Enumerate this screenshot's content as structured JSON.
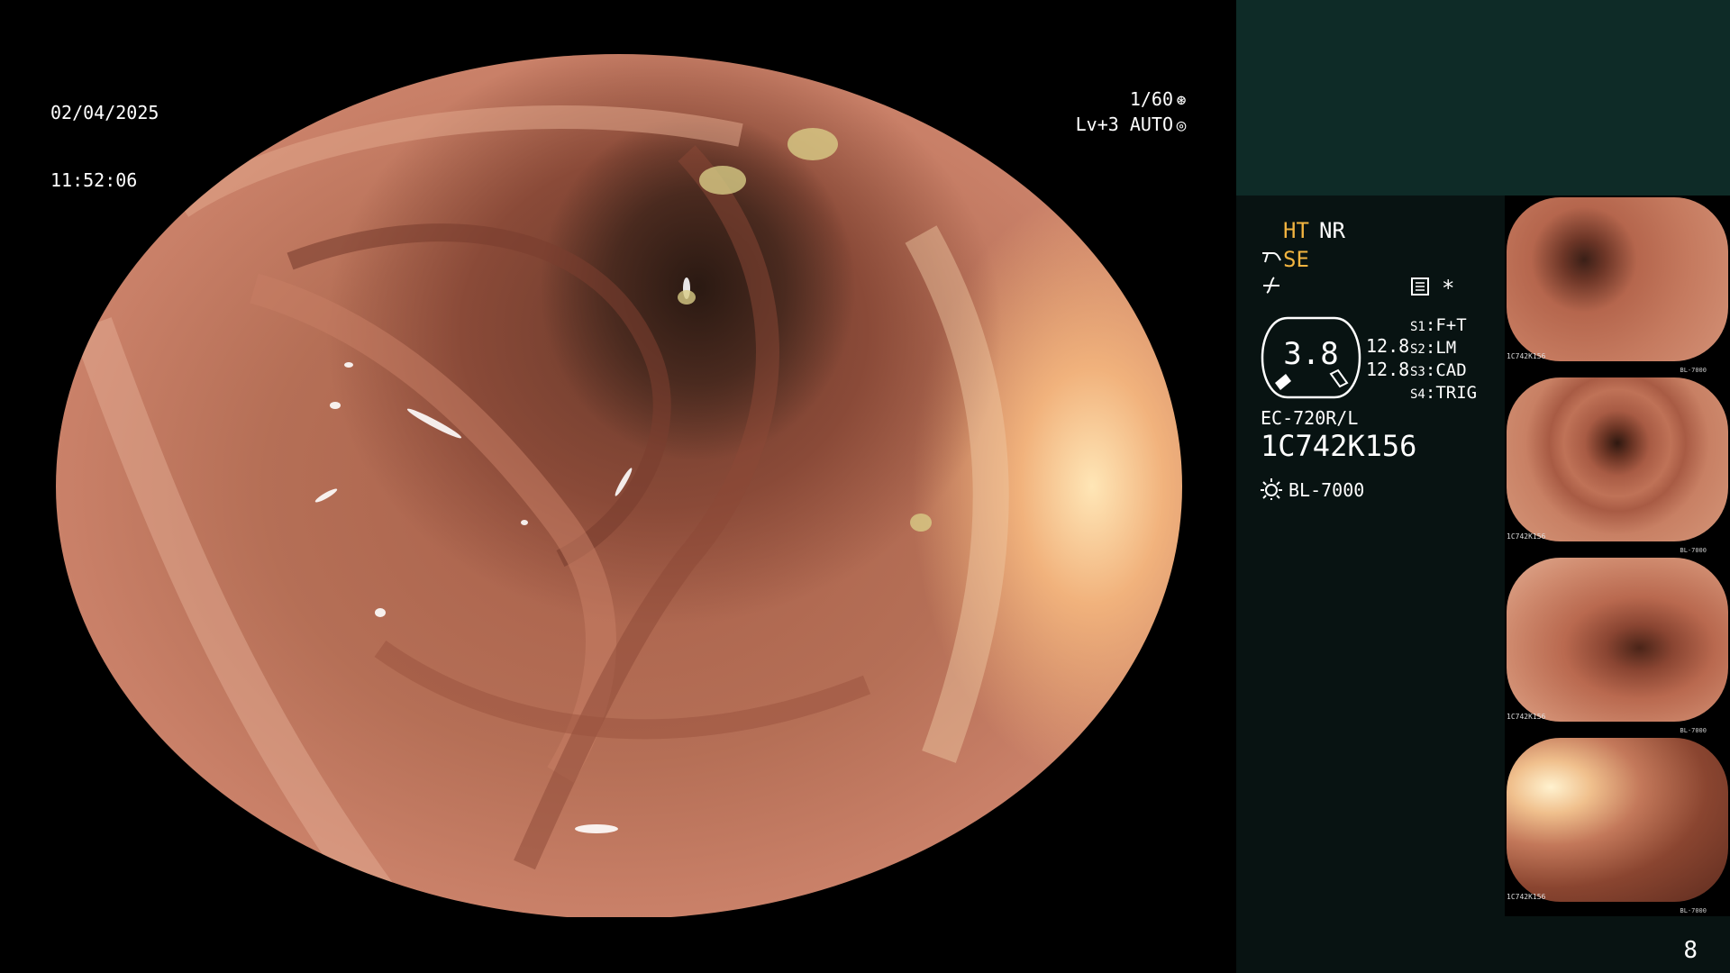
{
  "overlay": {
    "date": "02/04/2025",
    "time": "11:52:06",
    "shutter": "1/60",
    "level": "Lv+3",
    "iris": "AUTO"
  },
  "panel": {
    "mode_ht": "HT",
    "mode_nr": "NR",
    "mode_se": "SE",
    "star": "*",
    "gauge_value": "3.8",
    "gauge_side_a": "12.8",
    "gauge_side_b": "12.8",
    "switches": [
      {
        "key": "S1",
        "value": "F+T"
      },
      {
        "key": "S2",
        "value": "LM"
      },
      {
        "key": "S3",
        "value": "CAD"
      },
      {
        "key": "S4",
        "value": "TRIG"
      }
    ],
    "scope_model": "EC-720R/L",
    "scope_serial": "1C742K156",
    "light_source": "BL-7000",
    "page_number": "8"
  },
  "thumbnails": [
    {
      "caption": "1C742K156",
      "footer": "BL-7000"
    },
    {
      "caption": "1C742K156",
      "footer": "BL-7000"
    },
    {
      "caption": "1C742K156",
      "footer": "BL-7000"
    },
    {
      "caption": "1C742K156",
      "footer": "BL-7000"
    }
  ],
  "colors": {
    "panel_top": "#0e2b27",
    "panel_body": "#081312",
    "amber_text": "#f2b440"
  }
}
